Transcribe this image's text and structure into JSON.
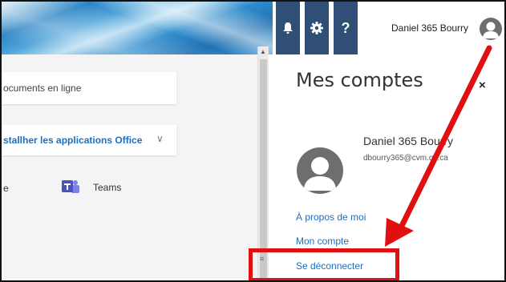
{
  "header": {
    "icons": [
      "bell-icon",
      "gear-icon",
      "help-icon"
    ],
    "help_glyph": "?",
    "user_name": "Daniel 365 Bourry",
    "brand_color": "#2f4f76"
  },
  "main": {
    "documents_text": "ocuments en ligne",
    "install_label": "stallher les applications Office",
    "install_chevron": "∨",
    "apps": [
      {
        "label": "e"
      },
      {
        "label": "Teams",
        "icon": "teams-icon"
      }
    ]
  },
  "account_panel": {
    "title": "Mes comptes",
    "close_glyph": "×",
    "name": "Daniel 365 Bourry",
    "email": "dbourry365@cvm.qc.ca",
    "links": [
      "À propos de moi",
      "Mon compte",
      "Se déconnecter"
    ],
    "link_color": "#1a6fc2"
  },
  "annotation": {
    "color": "#e01010"
  }
}
